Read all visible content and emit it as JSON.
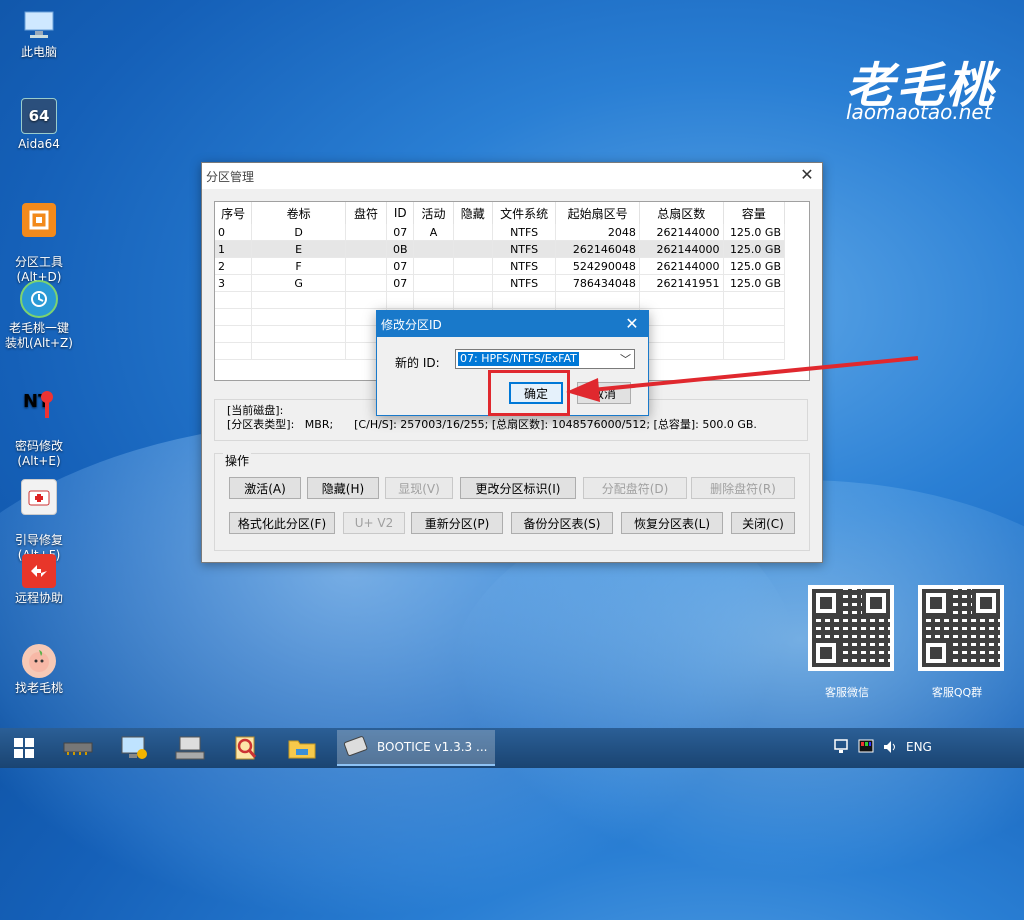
{
  "desktop": {
    "icons": [
      {
        "label": "此电脑"
      },
      {
        "label": "Aida64",
        "glyph": "64"
      },
      {
        "label": "分区工具\n(Alt+D)"
      },
      {
        "label": "老毛桃一键装机(Alt+Z)"
      },
      {
        "label": "密码修改\n(Alt+E)"
      },
      {
        "label": "引导修复\n(Alt+F)"
      },
      {
        "label": "远程协助"
      },
      {
        "label": "找老毛桃"
      }
    ],
    "logo_cn": "老毛桃",
    "logo_en": "laomaotao.net",
    "qr_labels": [
      "客服微信",
      "客服QQ群"
    ]
  },
  "window": {
    "title": "分区管理",
    "columns": [
      "序号",
      "卷标",
      "盘符",
      "ID",
      "活动",
      "隐藏",
      "文件系统",
      "起始扇区号",
      "总扇区数",
      "容量"
    ],
    "rows": [
      {
        "no": "0",
        "label": "D",
        "letter": "",
        "id": "07",
        "active": "A",
        "hidden": "",
        "fs": "NTFS",
        "start": "2048",
        "total": "262144000",
        "size": "125.0 GB"
      },
      {
        "no": "1",
        "label": "E",
        "letter": "",
        "id": "0B",
        "active": "",
        "hidden": "",
        "fs": "NTFS",
        "start": "262146048",
        "total": "262144000",
        "size": "125.0 GB"
      },
      {
        "no": "2",
        "label": "F",
        "letter": "",
        "id": "07",
        "active": "",
        "hidden": "",
        "fs": "NTFS",
        "start": "524290048",
        "total": "262144000",
        "size": "125.0 GB"
      },
      {
        "no": "3",
        "label": "G",
        "letter": "",
        "id": "07",
        "active": "",
        "hidden": "",
        "fs": "NTFS",
        "start": "786434048",
        "total": "262141951",
        "size": "125.0 GB"
      }
    ],
    "info_line1": "[当前磁盘]:",
    "info_line2": "[分区表类型]:   MBR;      [C/H/S]: 257003/16/255; [总扇区数]: 1048576000/512; [总容量]: 500.0 GB.",
    "ops_title": "操作",
    "buttons": {
      "activate": "激活(A)",
      "hide": "隐藏(H)",
      "show": "显现(V)",
      "change_id": "更改分区标识(I)",
      "assign_letter": "分配盘符(D)",
      "remove_letter": "删除盘符(R)",
      "format": "格式化此分区(F)",
      "uv2": "U+ V2",
      "repartition": "重新分区(P)",
      "backup": "备份分区表(S)",
      "restore": "恢复分区表(L)",
      "close": "关闭(C)"
    }
  },
  "dialog": {
    "title": "修改分区ID",
    "label": "新的 ID:",
    "selected": "07: HPFS/NTFS/ExFAT",
    "ok": "确定",
    "cancel": "取消"
  },
  "taskbar": {
    "app_title": "BOOTICE v1.3.3 ...",
    "lang": "ENG"
  },
  "colors": {
    "accent": "#1979ca",
    "highlight": "#e0282e"
  }
}
